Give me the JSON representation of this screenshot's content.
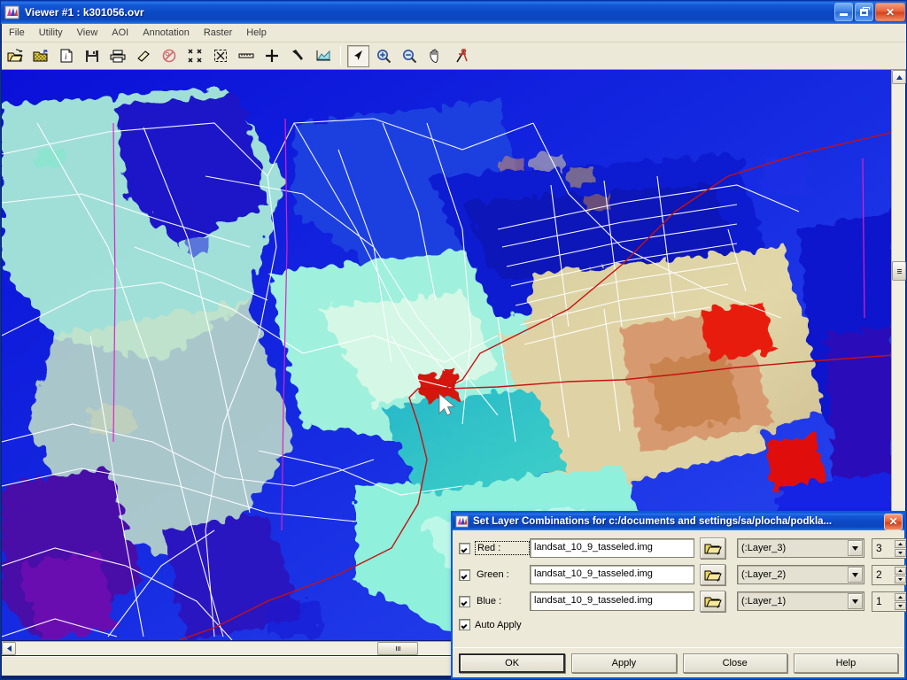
{
  "window": {
    "title": "Viewer #1 : k301056.ovr",
    "icon": "erdas-viewer-icon",
    "controls": [
      {
        "name": "minimize-button",
        "glyph": "minimize-icon"
      },
      {
        "name": "restore-button",
        "glyph": "restore-icon"
      },
      {
        "name": "close-button",
        "glyph": "close-icon"
      }
    ]
  },
  "menubar": {
    "items": [
      {
        "label": "File"
      },
      {
        "label": "Utility"
      },
      {
        "label": "View"
      },
      {
        "label": "AOI"
      },
      {
        "label": "Annotation"
      },
      {
        "label": "Raster"
      },
      {
        "label": "Help"
      }
    ]
  },
  "toolbar": {
    "buttons": [
      {
        "name": "open-file-button",
        "icon": "open-folder-icon"
      },
      {
        "name": "new-file-button",
        "icon": "new-folder-icon"
      },
      {
        "name": "image-info-button",
        "icon": "info-document-icon"
      },
      {
        "name": "save-button",
        "icon": "floppy-disk-icon"
      },
      {
        "name": "print-button",
        "icon": "printer-icon"
      },
      {
        "name": "eraser-button",
        "icon": "eraser-icon"
      },
      {
        "name": "clear-view-button",
        "icon": "no-entry-icon"
      },
      {
        "name": "zoom-to-fit-button",
        "icon": "contract-arrows-icon"
      },
      {
        "name": "fit-window-button",
        "icon": "expand-arrows-icon"
      },
      {
        "name": "measure-button",
        "icon": "ruler-icon"
      },
      {
        "name": "crosshair-button",
        "icon": "crosshair-icon"
      },
      {
        "name": "inquire-button",
        "icon": "hammer-icon"
      },
      {
        "name": "profile-button",
        "icon": "chart-icon"
      },
      {
        "name": "select-tool-button",
        "icon": "arrow-pointer-icon",
        "pressed": true
      },
      {
        "name": "zoom-in-button",
        "icon": "zoom-in-icon"
      },
      {
        "name": "zoom-out-button",
        "icon": "zoom-out-icon"
      },
      {
        "name": "pan-button",
        "icon": "hand-icon"
      },
      {
        "name": "geo-link-button",
        "icon": "compass-pin-icon"
      }
    ]
  },
  "viewport": {
    "name": "raster-image-canvas",
    "description": "Landsat tasseled-cap false-colour raster with white cadastral vector overlay and red boundary line",
    "cursor": "arrow-cursor"
  },
  "scrollbars": {
    "vertical": {
      "up_glyph": "▲",
      "down_glyph": "▼",
      "thumb_grip": "grip-icon"
    },
    "horizontal": {
      "left_glyph": "◀",
      "right_glyph": "▶",
      "thumb_grip": "grip-icon"
    }
  },
  "dialog": {
    "title": "Set Layer Combinations for c:/documents and settings/sa/plocha/podkla...",
    "icon": "erdas-viewer-icon",
    "close_glyph": "close-icon",
    "rows": [
      {
        "checked": true,
        "label": "Red :",
        "focused": true,
        "filename": "landsat_10_9_tasseled.img",
        "browse_icon": "open-folder-icon",
        "layer": "(:Layer_3)",
        "number": "3"
      },
      {
        "checked": true,
        "label": "Green :",
        "focused": false,
        "filename": "landsat_10_9_tasseled.img",
        "browse_icon": "open-folder-icon",
        "layer": "(:Layer_2)",
        "number": "2"
      },
      {
        "checked": true,
        "label": "Blue :",
        "focused": false,
        "filename": "landsat_10_9_tasseled.img",
        "browse_icon": "open-folder-icon",
        "layer": "(:Layer_1)",
        "number": "1"
      }
    ],
    "auto_apply": {
      "checked": true,
      "label": "Auto Apply"
    },
    "buttons": [
      {
        "label": "OK",
        "default": true
      },
      {
        "label": "Apply",
        "default": false
      },
      {
        "label": "Close",
        "default": false
      },
      {
        "label": "Help",
        "default": false
      }
    ]
  },
  "colors": {
    "titlebar_blue": "#0c49c4",
    "dialog_face": "#ece9d8",
    "close_red": "#d4411c",
    "overlay_white": "#ffffff",
    "boundary_red": "#c81010"
  }
}
